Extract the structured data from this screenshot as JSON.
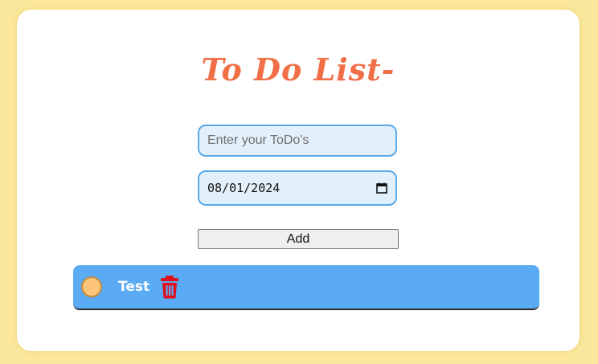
{
  "app": {
    "title": "To Do List-"
  },
  "form": {
    "todo_placeholder": "Enter your ToDo's",
    "todo_value": "",
    "date_value": "08/01/2024",
    "add_label": "Add"
  },
  "todos": [
    {
      "text": "Test",
      "done": false
    }
  ],
  "colors": {
    "page_background": "#fbe79b",
    "title": "#f06f47",
    "input_border": "#5aa9e8",
    "input_background": "#e2f0fb",
    "todo_item_background": "#5aabf3",
    "checkbox_fill": "#fdc57a",
    "trash": "#e0101a"
  },
  "icons": {
    "date_picker": "calendar-icon",
    "todo_status": "circle-checkbox-icon",
    "delete": "trash-icon"
  }
}
